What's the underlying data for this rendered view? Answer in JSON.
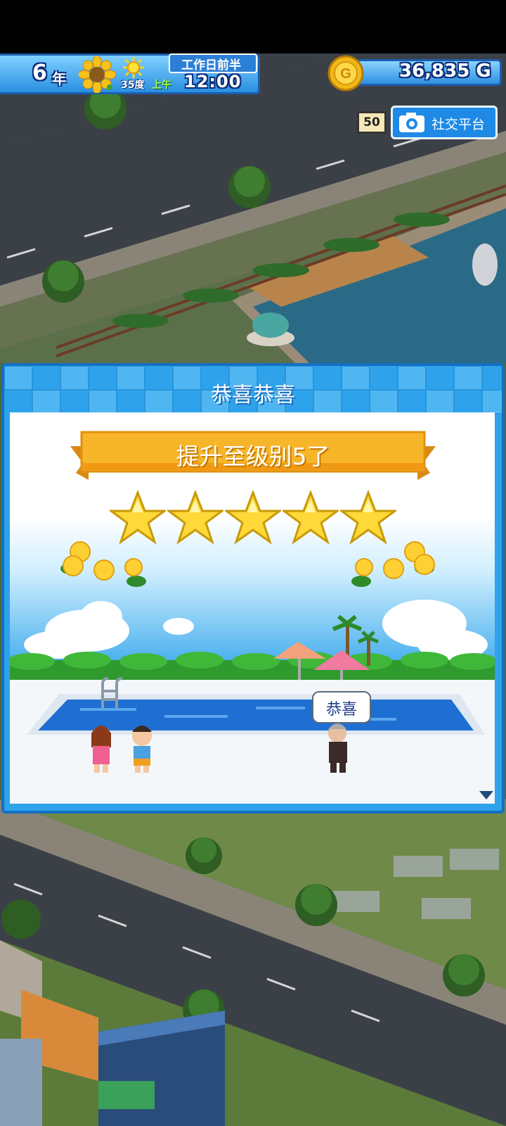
{
  "hud": {
    "year_number": "6",
    "year_unit": "年",
    "season_icon": "sunflower-icon",
    "weather_icon": "sun-icon",
    "temperature": "35度",
    "period": "工作日前半",
    "ampm": "上午",
    "time": "12:00",
    "money": "36,835 G",
    "coin_icon": "gold-coin-icon",
    "badge": "50",
    "social_label": "社交平台",
    "camera_icon": "camera-icon"
  },
  "dialog": {
    "title": "恭喜恭喜",
    "ribbon_text": "提升至级别5了",
    "stars": [
      "star-1",
      "star-2",
      "star-3",
      "star-4",
      "star-5"
    ],
    "stars_filled": 5,
    "speech": "恭喜",
    "next_icon": "triangle-down-icon"
  },
  "colors": {
    "accent_blue": "#2ea2ea",
    "ribbon_gold": "#f7b52a",
    "star_gold": "#ffd83a"
  }
}
